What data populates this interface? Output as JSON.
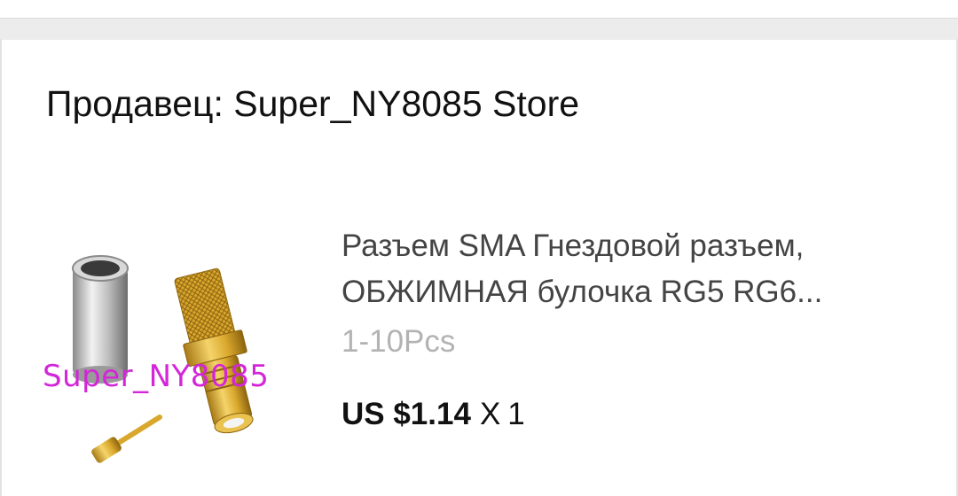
{
  "seller": {
    "label": "Продавец: Super_NY8085 Store"
  },
  "product": {
    "title": "Разъем SMA Гнездовой разъем, ОБЖИМНАЯ булочка RG5 RG6...",
    "variant": "1-10Pcs",
    "price": "US $1.14",
    "qty_prefix": "X",
    "qty": "1",
    "image": {
      "watermark": "Super_NY8085",
      "watermark_color": "#d326d8",
      "depicts": "SMA connector icon"
    }
  }
}
